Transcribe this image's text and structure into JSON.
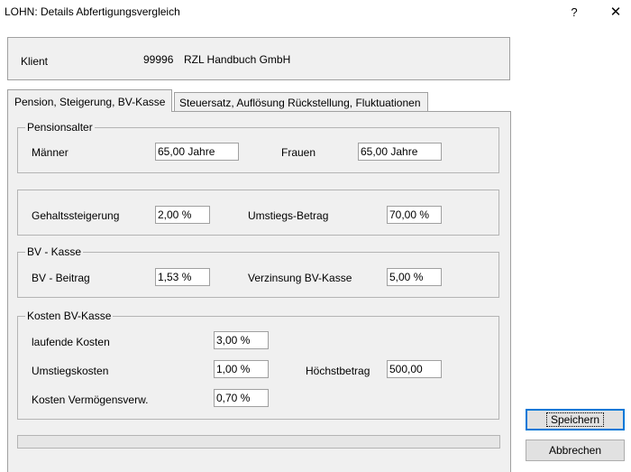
{
  "window": {
    "title": "LOHN: Details Abfertigungsvergleich",
    "help_glyph": "?",
    "close_glyph": "✕"
  },
  "client": {
    "label": "Klient",
    "number": "99996",
    "name": "RZL Handbuch GmbH"
  },
  "tabs": [
    {
      "label": "Pension, Steigerung, BV-Kasse",
      "active": true
    },
    {
      "label": "Steuersatz, Auflösung Rückstellung, Fluktuationen",
      "active": false
    }
  ],
  "pensionsalter": {
    "legend": "Pensionsalter",
    "maenner_label": "Männer",
    "maenner_value": "65,00  Jahre",
    "frauen_label": "Frauen",
    "frauen_value": "65,00  Jahre"
  },
  "steigerung": {
    "gehalt_label": "Gehaltssteigerung",
    "gehalt_value": "2,00  %",
    "umstieg_label": "Umstiegs-Betrag",
    "umstieg_value": "70,00  %"
  },
  "bvkasse": {
    "legend": "BV - Kasse",
    "beitrag_label": "BV - Beitrag",
    "beitrag_value": "1,53  %",
    "verzinsung_label": "Verzinsung BV-Kasse",
    "verzinsung_value": "5,00  %"
  },
  "kosten": {
    "legend": "Kosten BV-Kasse",
    "laufend_label": "laufende Kosten",
    "laufend_value": "3,00  %",
    "umstieg_label": "Umstiegskosten",
    "umstieg_value": "1,00  %",
    "hoechst_label": "Höchstbetrag",
    "hoechst_value": "500,00",
    "verm_label": "Kosten Vermögensverw.",
    "verm_value": "0,70  %"
  },
  "buttons": {
    "save": "Speichern",
    "cancel": "Abbrechen"
  }
}
